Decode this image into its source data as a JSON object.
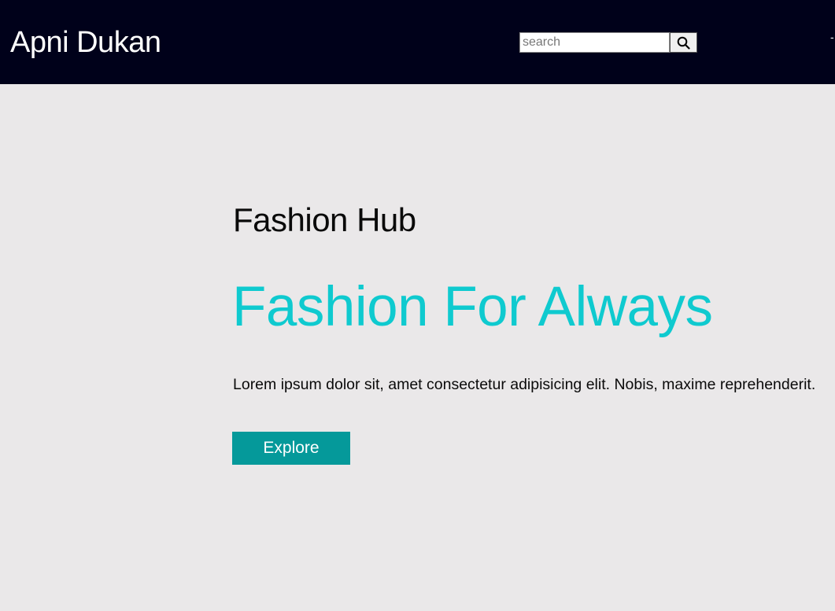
{
  "navbar": {
    "brand": "Apni Dukan",
    "search": {
      "placeholder": "search",
      "value": "",
      "button_icon": "search-icon"
    },
    "edge_glyph": "-"
  },
  "hero": {
    "kicker": "Fashion Hub",
    "title": "Fashion For Always",
    "text": "Lorem ipsum dolor sit, amet consectetur adipisicing elit. Nobis, maxime reprehenderit.",
    "cta_label": "Explore"
  },
  "colors": {
    "navbar_bg": "#00011a",
    "page_bg": "#eae8e9",
    "accent_title": "#0fcacf",
    "button_bg": "#05999a"
  }
}
